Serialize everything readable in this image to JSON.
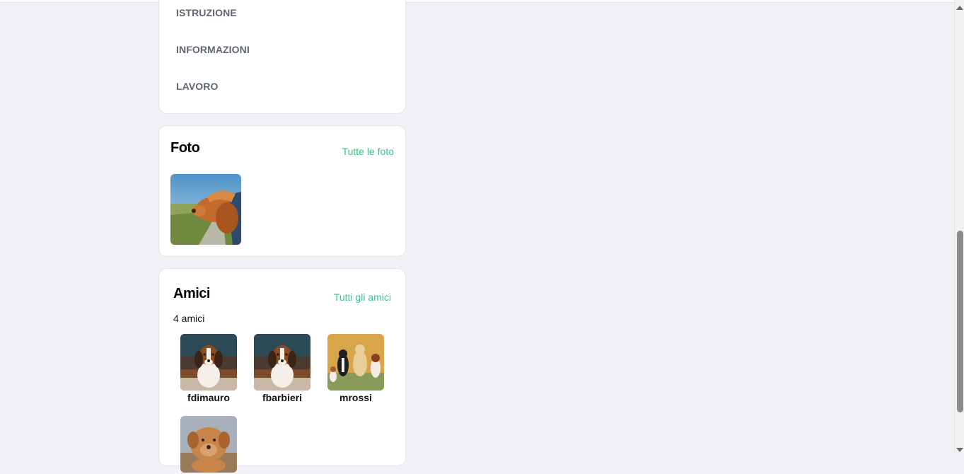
{
  "info_menu": {
    "items": [
      {
        "label": "ISTRUZIONE"
      },
      {
        "label": "INFORMAZIONI"
      },
      {
        "label": "LAVORO"
      }
    ]
  },
  "photos": {
    "title": "Foto",
    "link": "Tutte le foto",
    "items": [
      {
        "subject": "dog-in-car-window"
      }
    ]
  },
  "friends": {
    "title": "Amici",
    "link": "Tutti gli amici",
    "count": "4 amici",
    "items": [
      {
        "name": "fdimauro",
        "picture": "beagle-puppy"
      },
      {
        "name": "fbarbieri",
        "picture": "beagle-puppy"
      },
      {
        "name": "mrossi",
        "picture": "group-of-dogs"
      },
      {
        "name": "",
        "picture": "mastiff-puppy"
      }
    ]
  },
  "colors": {
    "accent": "#3cc38a",
    "background": "#f0f2f5",
    "card": "#ffffff",
    "menu_text": "#5f6671"
  }
}
